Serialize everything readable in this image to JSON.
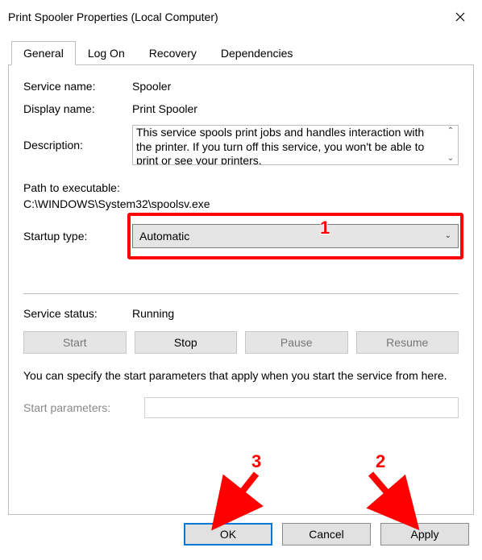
{
  "window": {
    "title": "Print Spooler Properties (Local Computer)"
  },
  "tabs": [
    "General",
    "Log On",
    "Recovery",
    "Dependencies"
  ],
  "active_tab": 0,
  "service": {
    "name_label": "Service name:",
    "name": "Spooler",
    "display_label": "Display name:",
    "display": "Print Spooler",
    "desc_label": "Description:",
    "description": "This service spools print jobs and handles interaction with the printer.  If you turn off this service, you won't be able to print or see your printers.",
    "path_label": "Path to executable:",
    "path": "C:\\WINDOWS\\System32\\spoolsv.exe",
    "startup_label": "Startup type:",
    "startup_value": "Automatic",
    "status_label": "Service status:",
    "status_value": "Running"
  },
  "buttons": {
    "start": "Start",
    "stop": "Stop",
    "pause": "Pause",
    "resume": "Resume"
  },
  "note": "You can specify the start parameters that apply when you start the service from here.",
  "params": {
    "label": "Start parameters:",
    "value": ""
  },
  "dialog": {
    "ok": "OK",
    "cancel": "Cancel",
    "apply": "Apply"
  },
  "annotations": {
    "a1": "1",
    "a2": "2",
    "a3": "3"
  }
}
